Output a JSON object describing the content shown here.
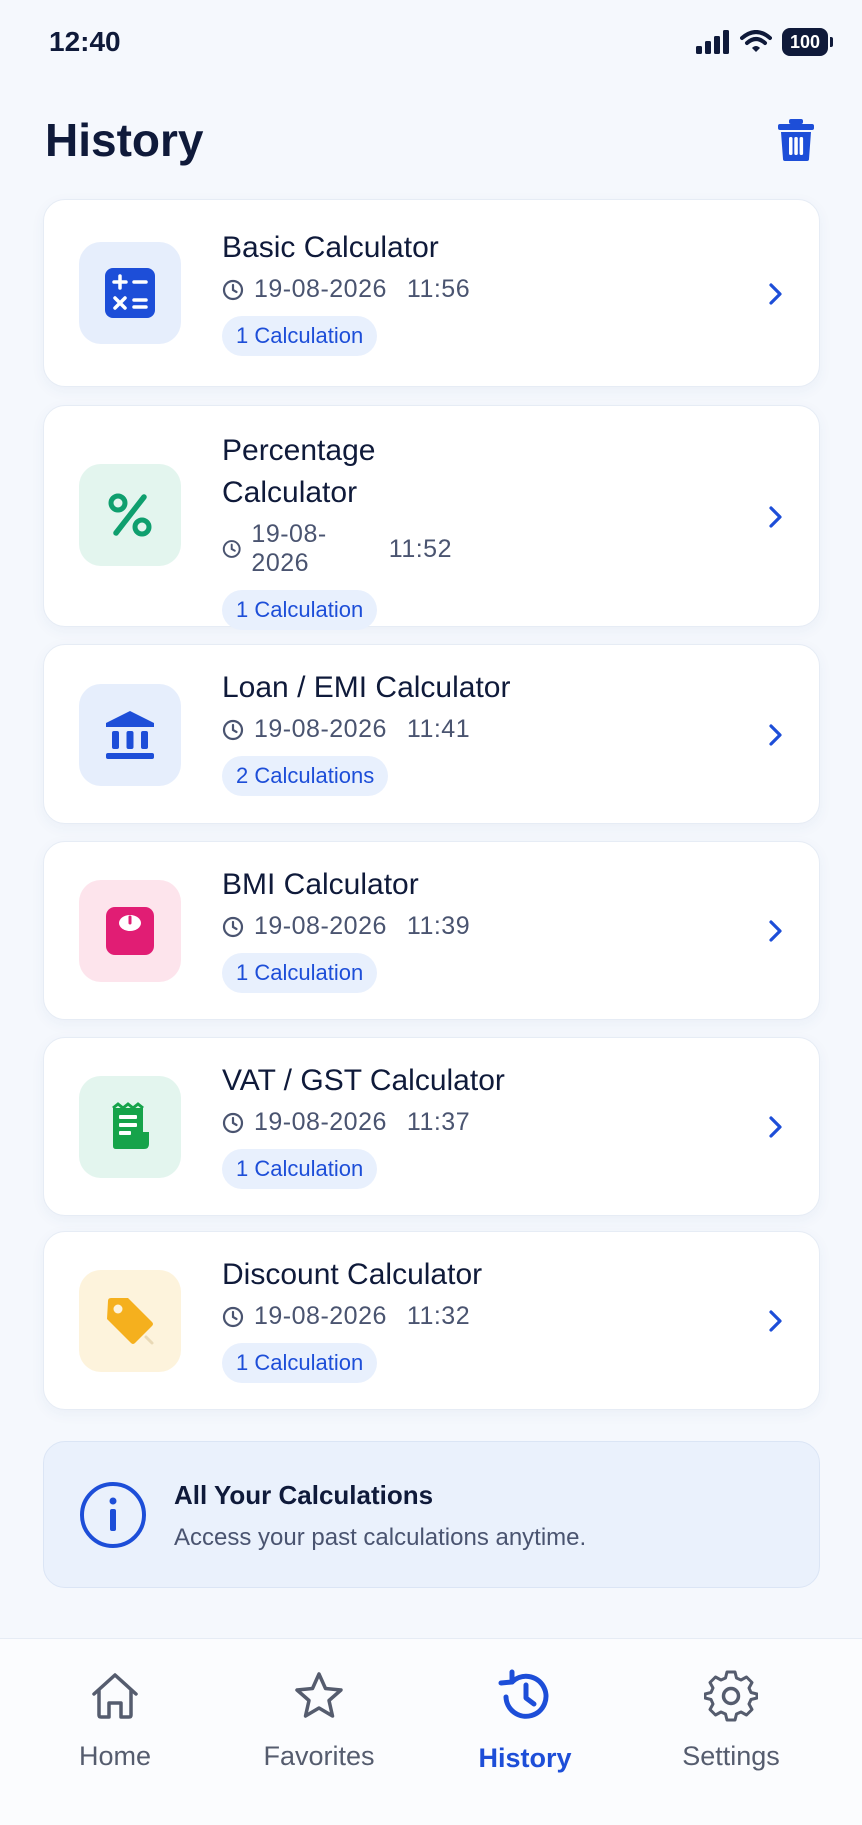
{
  "status_bar": {
    "time": "12:40",
    "battery": "100"
  },
  "header": {
    "title": "History"
  },
  "history_items": [
    {
      "title": "Basic Calculator",
      "date": "19-08-2026",
      "time": "11:56",
      "badge": "1 Calculation",
      "icon": "calculator-icon",
      "icon_bg": "#e6eefc",
      "icon_color": "#1d4ed8"
    },
    {
      "title": "Percentage Calculator",
      "date": "19-08-2026",
      "time": "11:52",
      "badge": "1 Calculation",
      "icon": "percent-icon",
      "icon_bg": "#e3f5ee",
      "icon_color": "#0f9f6e"
    },
    {
      "title": "Loan / EMI Calculator",
      "date": "19-08-2026",
      "time": "11:41",
      "badge": "2 Calculations",
      "icon": "bank-icon",
      "icon_bg": "#e6eefc",
      "icon_color": "#1d4ed8"
    },
    {
      "title": "BMI Calculator",
      "date": "19-08-2026",
      "time": "11:39",
      "badge": "1 Calculation",
      "icon": "scale-icon",
      "icon_bg": "#fde4ec",
      "icon_color": "#e11d74"
    },
    {
      "title": "VAT / GST Calculator",
      "date": "19-08-2026",
      "time": "11:37",
      "badge": "1 Calculation",
      "icon": "receipt-icon",
      "icon_bg": "#e3f5ee",
      "icon_color": "#16a34a"
    },
    {
      "title": "Discount Calculator",
      "date": "19-08-2026",
      "time": "11:32",
      "badge": "1 Calculation",
      "icon": "tag-icon",
      "icon_bg": "#fdf3dc",
      "icon_color": "#f5b01e"
    }
  ],
  "info": {
    "title": "All Your Calculations",
    "subtitle": "Access your past calculations anytime."
  },
  "nav": [
    {
      "label": "Home",
      "icon": "home-icon",
      "active": false
    },
    {
      "label": "Favorites",
      "icon": "star-icon",
      "active": false
    },
    {
      "label": "History",
      "icon": "history-icon",
      "active": true
    },
    {
      "label": "Settings",
      "icon": "gear-icon",
      "active": false
    }
  ],
  "colors": {
    "accent": "#1d4ed8",
    "text": "#0f1a3a",
    "muted": "#4a5470"
  }
}
